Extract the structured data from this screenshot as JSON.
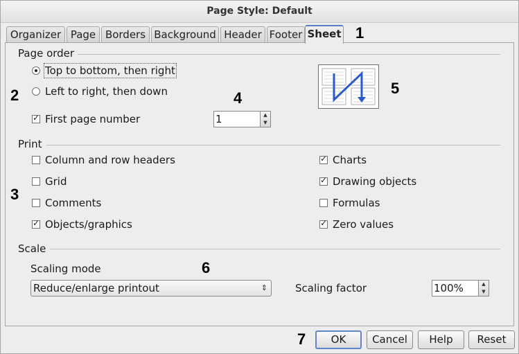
{
  "window": {
    "title": "Page Style: Default"
  },
  "tabs": [
    {
      "label": "Organizer"
    },
    {
      "label": "Page"
    },
    {
      "label": "Borders"
    },
    {
      "label": "Background"
    },
    {
      "label": "Header"
    },
    {
      "label": "Footer"
    },
    {
      "label": "Sheet",
      "active": true
    }
  ],
  "page_order": {
    "title": "Page order",
    "options": [
      {
        "label": "Top to bottom, then right",
        "selected": true
      },
      {
        "label": "Left to right, then down",
        "selected": false
      }
    ],
    "first_page_number": {
      "label": "First page number",
      "checked": true,
      "value": "1"
    },
    "preview_icon": "page-order-preview-icon"
  },
  "print": {
    "title": "Print",
    "left": [
      {
        "label": "Column and row headers",
        "checked": false
      },
      {
        "label": "Grid",
        "checked": false
      },
      {
        "label": "Comments",
        "checked": false
      },
      {
        "label": "Objects/graphics",
        "checked": true
      }
    ],
    "right": [
      {
        "label": "Charts",
        "checked": true
      },
      {
        "label": "Drawing objects",
        "checked": true
      },
      {
        "label": "Formulas",
        "checked": false
      },
      {
        "label": "Zero values",
        "checked": true
      }
    ]
  },
  "scale": {
    "title": "Scale",
    "mode_label": "Scaling mode",
    "mode_value": "Reduce/enlarge printout",
    "factor_label": "Scaling factor",
    "factor_value": "100%"
  },
  "buttons": {
    "ok": "OK",
    "cancel": "Cancel",
    "help": "Help",
    "reset": "Reset"
  },
  "callouts": [
    "1",
    "2",
    "3",
    "4",
    "5",
    "6",
    "7"
  ],
  "colors": {
    "preview_arrow": "#2a5bc8",
    "tab_accent": "#5a7ec4"
  }
}
